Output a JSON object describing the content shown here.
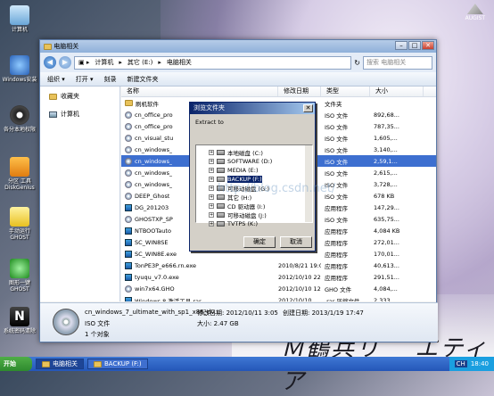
{
  "desktop": {
    "icons": [
      {
        "label": "计算机",
        "color": "#8cc6f0"
      },
      {
        "label": "Windows安装",
        "color": "#3c7fd0"
      },
      {
        "label": "分区 工具 DiskGenius",
        "color": "#f0a020"
      },
      {
        "label": "手动运行 GHOST",
        "color": "#f5d84a"
      },
      {
        "label": "图形一键 GHOST",
        "color": "#3fbf3f"
      },
      {
        "label": "系统密码清除",
        "color": "#202020"
      }
    ],
    "settings_icon_label": "各分本地权限",
    "brand": "AUGIST",
    "wallpaper_text": "Ｍ鶴兵リ゛ エティア"
  },
  "window": {
    "title": "电脑相关",
    "path": [
      "计算机",
      "其它 (E:)",
      "电脑相关"
    ],
    "search_placeholder": "搜索 电脑相关",
    "toolbar": [
      "组织 ▾",
      "打开 ▾",
      "刻录",
      "新建文件夹"
    ],
    "nav": [
      {
        "label": "收藏夹"
      },
      {
        "label": "计算机"
      }
    ],
    "columns": [
      "名称",
      "修改日期",
      "类型",
      "大小"
    ],
    "files": [
      {
        "name": "刷机软件",
        "date": "",
        "type": "文件夹",
        "size": "",
        "icon": "folder"
      },
      {
        "name": "cn_office_pro",
        "date": "",
        "type": "ISO 文件",
        "size": "892,68...",
        "icon": "disc"
      },
      {
        "name": "cn_office_pro",
        "date": "",
        "type": "ISO 文件",
        "size": "787,35...",
        "icon": "disc"
      },
      {
        "name": "cn_visual_stu",
        "date": "",
        "type": "ISO 文件",
        "size": "1,605,...",
        "icon": "disc"
      },
      {
        "name": "cn_windows_",
        "date": "",
        "type": "ISO 文件",
        "size": "3,140,...",
        "icon": "disc"
      },
      {
        "name": "cn_windows_",
        "date": "",
        "type": "ISO 文件",
        "size": "2,59,1...",
        "icon": "disc",
        "selected": true
      },
      {
        "name": "cn_windows_",
        "date": "",
        "type": "ISO 文件",
        "size": "2,615,...",
        "icon": "disc"
      },
      {
        "name": "cn_windows_",
        "date": "",
        "type": "ISO 文件",
        "size": "3,728,...",
        "icon": "disc"
      },
      {
        "name": "DEEP_Ghost",
        "date": "",
        "type": "ISO 文件",
        "size": "678 KB",
        "icon": "disc"
      },
      {
        "name": "DG_201203",
        "date": "",
        "type": "应用程序",
        "size": "147,29...",
        "icon": "exe"
      },
      {
        "name": "GHOSTXP_SP",
        "date": "",
        "type": "ISO 文件",
        "size": "635,75...",
        "icon": "disc"
      },
      {
        "name": "NTBOOTauto",
        "date": "",
        "type": "应用程序",
        "size": "4,084 KB",
        "icon": "exe"
      },
      {
        "name": "SC_WIN8SE",
        "date": "",
        "type": "应用程序",
        "size": "272,01...",
        "icon": "exe"
      },
      {
        "name": "SC_WIN8E.exe",
        "date": "",
        "type": "应用程序",
        "size": "170,01...",
        "icon": "exe"
      },
      {
        "name": "TonPE3P_e666.rn.exe",
        "date": "2010/8/21 19:09",
        "type": "应用程序",
        "size": "40,613...",
        "icon": "exe"
      },
      {
        "name": "tyuqu_v7.0.exe",
        "date": "2012/10/10 22:...",
        "type": "应用程序",
        "size": "291,51...",
        "icon": "exe"
      },
      {
        "name": "win7x64.GHO",
        "date": "2012/10/10 12:...",
        "type": "GHO 文件",
        "size": "4,084,...",
        "icon": "disc"
      },
      {
        "name": "Windows 8 激活工具.rar",
        "date": "2012/10/10 ...",
        "type": ".rar 压缩文件",
        "size": "2,333,...",
        "icon": "exe"
      }
    ],
    "details": {
      "name": "cn_windows_7_ultimate_with_sp1_x86_dv...",
      "modified_label": "修改日期:",
      "modified": "2012/10/11 3:05",
      "created_label": "创建日期:",
      "created": "2013/1/19 17:47",
      "type": "ISO 文件",
      "size_label": "大小:",
      "size": "2.47 GB",
      "count": "1 个对象"
    }
  },
  "dialog": {
    "title": "浏览文件夹",
    "hint": "Extract to",
    "tree": [
      {
        "label": "本地磁盘 (C:)",
        "icon": "drive"
      },
      {
        "label": "SOFTWARE (D:)",
        "icon": "drive"
      },
      {
        "label": "MEDIA (E:)",
        "icon": "drive"
      },
      {
        "label": "BACKUP (F:)",
        "icon": "drive",
        "selected": true
      },
      {
        "label": "可移动磁盘 (G:)",
        "icon": "drive"
      },
      {
        "label": "其它 (H:)",
        "icon": "drive"
      },
      {
        "label": "CD 驱动器 (I:)",
        "icon": "cd"
      },
      {
        "label": "可移动磁盘 (J:)",
        "icon": "drive"
      },
      {
        "label": "TVTPS (K:)",
        "icon": "drive"
      }
    ],
    "ok": "确定",
    "cancel": "取消",
    "watermark": "http://blog.csdn.net/"
  },
  "taskbar": {
    "start": "开始",
    "tasks": [
      "电脑相关",
      "BACKUP (F:)"
    ],
    "lang": "CH",
    "clock": "18:40"
  }
}
